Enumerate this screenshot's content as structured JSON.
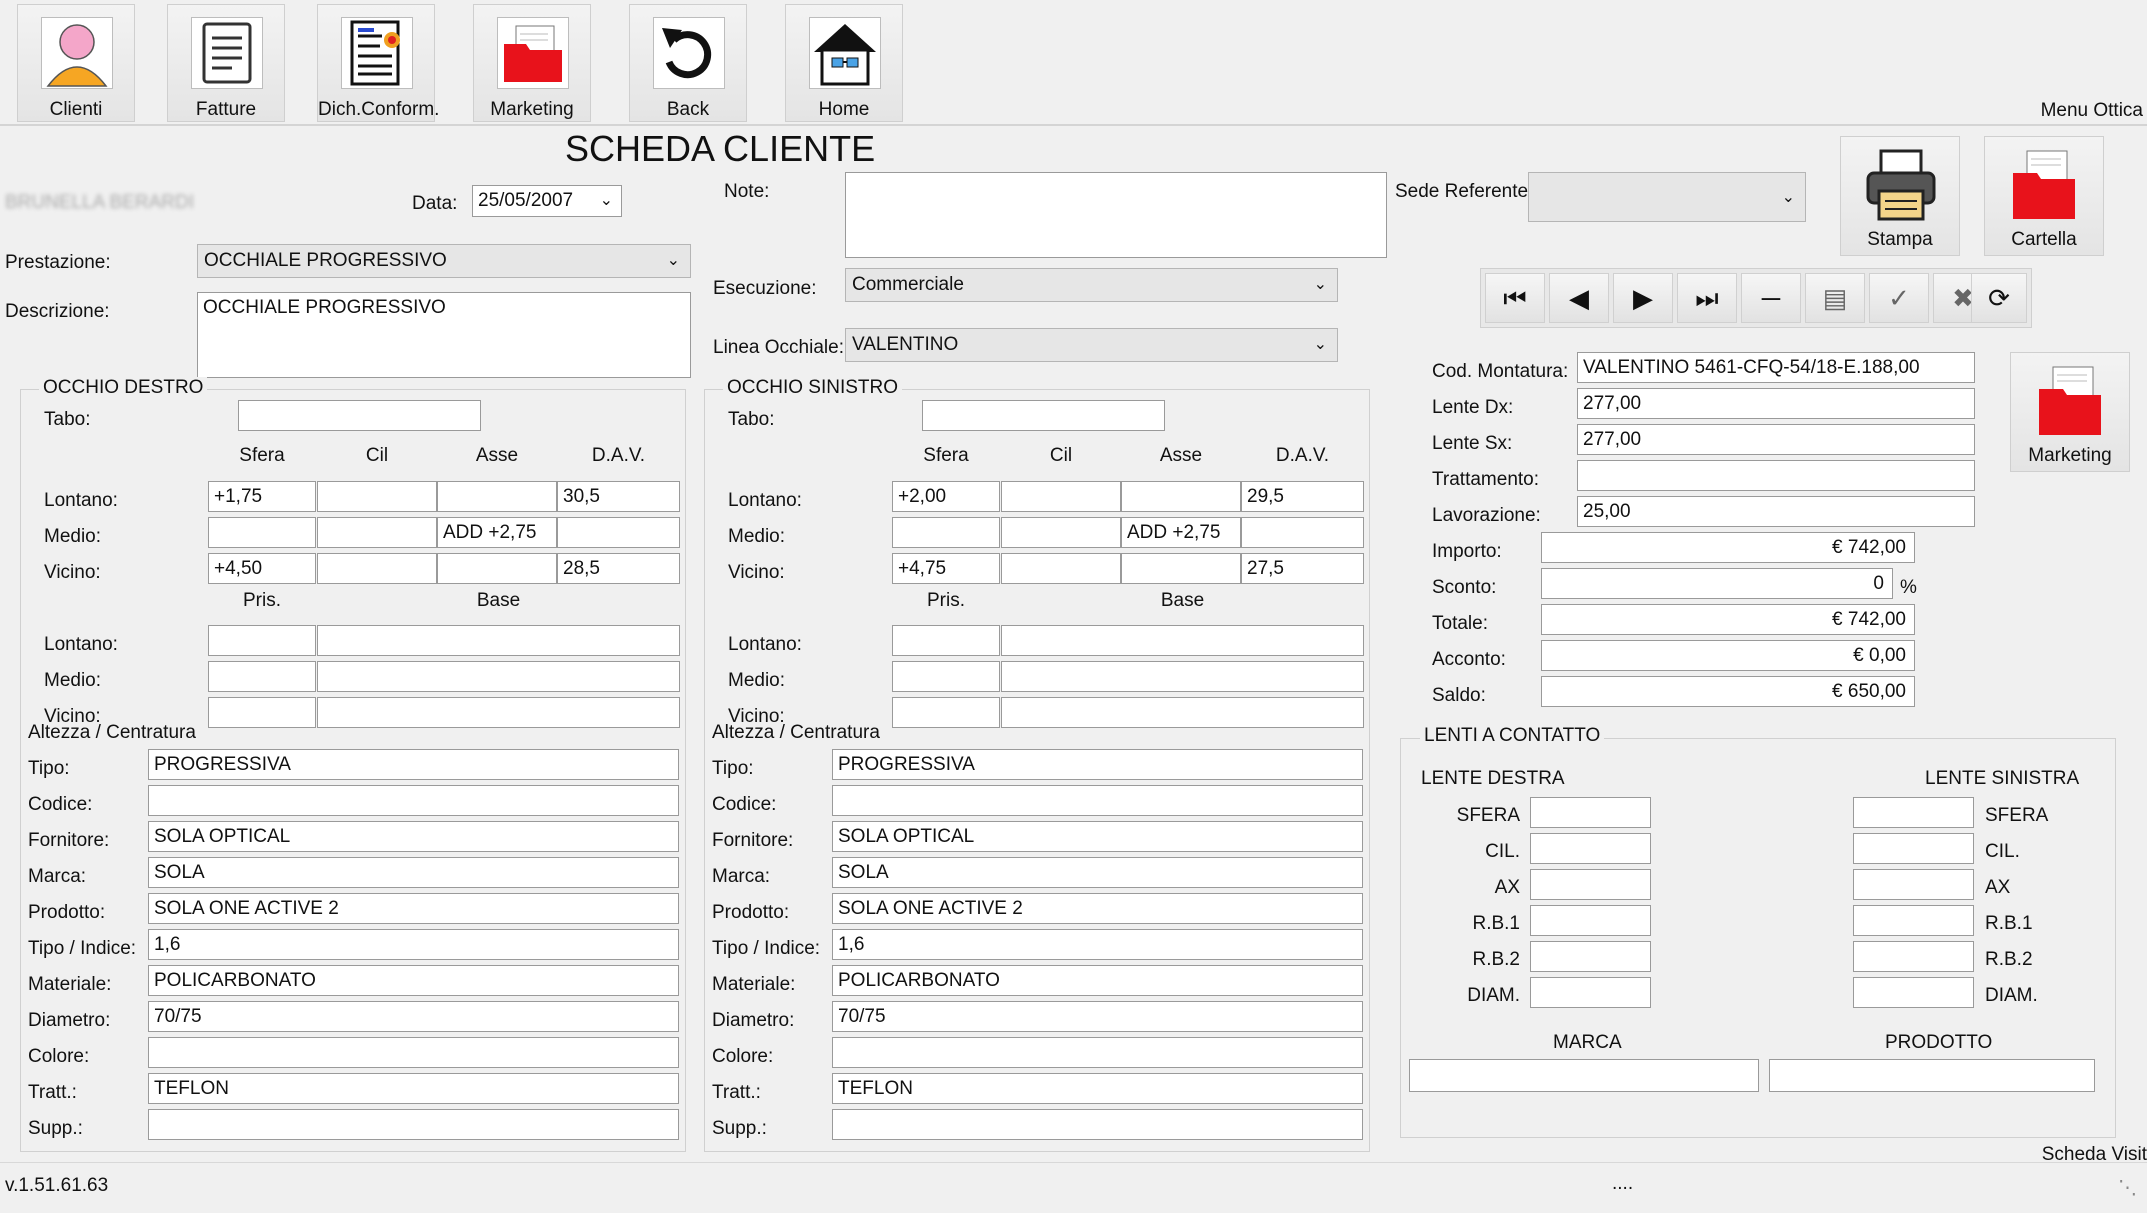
{
  "toolbar": {
    "buttons": [
      {
        "label": "Clienti",
        "icon": "person-icon"
      },
      {
        "label": "Fatture",
        "icon": "invoice-icon"
      },
      {
        "label": "Dich.Conform.",
        "icon": "document-seal-icon"
      },
      {
        "label": "Marketing",
        "icon": "folder-icon"
      },
      {
        "label": "Back",
        "icon": "undo-icon"
      },
      {
        "label": "Home",
        "icon": "home-icon"
      }
    ],
    "menu_label": "Menu Ottica"
  },
  "form": {
    "title": "SCHEDA CLIENTE",
    "customer_name": "BRUNELLA BERARDI",
    "data_label": "Data:",
    "data_value": "25/05/2007",
    "note_label": "Note:",
    "note_value": "",
    "sede_label": "Sede Referente:",
    "sede_value": "",
    "prestazione_label": "Prestazione:",
    "prestazione_value": "OCCHIALE PROGRESSIVO",
    "descrizione_label": "Descrizione:",
    "descrizione_value": "OCCHIALE PROGRESSIVO",
    "esecuzione_label": "Esecuzione:",
    "esecuzione_value": "Commerciale",
    "linea_label": "Linea Occhiale:",
    "linea_value": "VALENTINO"
  },
  "actions": {
    "stampa": "Stampa",
    "cartella": "Cartella",
    "marketing": "Marketing"
  },
  "eye_labels": {
    "tabo": "Tabo:",
    "sfera": "Sfera",
    "cil": "Cil",
    "asse": "Asse",
    "dav": "D.A.V.",
    "lontano": "Lontano:",
    "medio": "Medio:",
    "vicino": "Vicino:",
    "pris": "Pris.",
    "base": "Base",
    "altezza": "Altezza / Centratura",
    "tipo": "Tipo:",
    "codice": "Codice:",
    "fornitore": "Fornitore:",
    "marca": "Marca:",
    "prodotto": "Prodotto:",
    "tipo_indice": "Tipo / Indice:",
    "materiale": "Materiale:",
    "diametro": "Diametro:",
    "colore": "Colore:",
    "tratt": "Tratt.:",
    "supp": "Supp.:"
  },
  "occhio_destro": {
    "title": "OCCHIO DESTRO",
    "tabo": "",
    "lontano": {
      "sfera": "+1,75",
      "cil": "",
      "asse": "",
      "dav": "30,5"
    },
    "medio": {
      "sfera": "",
      "cil": "",
      "asse": "ADD +2,75",
      "dav": ""
    },
    "vicino": {
      "sfera": "+4,50",
      "cil": "",
      "asse": "",
      "dav": "28,5"
    },
    "tipo": "PROGRESSIVA",
    "codice": "",
    "fornitore": "SOLA OPTICAL",
    "marca": "SOLA",
    "prodotto": "SOLA ONE ACTIVE 2",
    "tipo_indice": "1,6",
    "materiale": "POLICARBONATO",
    "diametro": "70/75",
    "colore": "",
    "tratt": "TEFLON",
    "supp": ""
  },
  "occhio_sinistro": {
    "title": "OCCHIO SINISTRO",
    "tabo": "",
    "lontano": {
      "sfera": "+2,00",
      "cil": "",
      "asse": "",
      "dav": "29,5"
    },
    "medio": {
      "sfera": "",
      "cil": "",
      "asse": "ADD +2,75",
      "dav": ""
    },
    "vicino": {
      "sfera": "+4,75",
      "cil": "",
      "asse": "",
      "dav": "27,5"
    },
    "tipo": "PROGRESSIVA",
    "codice": "",
    "fornitore": "SOLA OPTICAL",
    "marca": "SOLA",
    "prodotto": "SOLA ONE ACTIVE 2",
    "tipo_indice": "1,6",
    "materiale": "POLICARBONATO",
    "diametro": "70/75",
    "colore": "",
    "tratt": "TEFLON",
    "supp": ""
  },
  "montatura": {
    "cod_label": "Cod. Montatura:",
    "cod_value": "VALENTINO 5461-CFQ-54/18-E.188,00",
    "dx_label": "Lente Dx:",
    "dx_value": "277,00",
    "sx_label": "Lente Sx:",
    "sx_value": "277,00",
    "trattamento_label": "Trattamento:",
    "trattamento_value": "",
    "lavorazione_label": "Lavorazione:",
    "lavorazione_value": "25,00",
    "importo_label": "Importo:",
    "importo_value": "€ 742,00",
    "sconto_label": "Sconto:",
    "sconto_value": "0",
    "sconto_unit": "%",
    "totale_label": "Totale:",
    "totale_value": "€ 742,00",
    "acconto_label": "Acconto:",
    "acconto_value": "€ 0,00",
    "saldo_label": "Saldo:",
    "saldo_value": "€ 650,00"
  },
  "lenti_contatto": {
    "title": "LENTI A CONTATTO",
    "destra": "LENTE DESTRA",
    "sinistra": "LENTE SINISTRA",
    "rows": [
      "SFERA",
      "CIL.",
      "AX",
      "R.B.1",
      "R.B.2",
      "DIAM."
    ],
    "marca": "MARCA",
    "prodotto": "PRODOTTO"
  },
  "footer": {
    "version": "v.1.51.61.63",
    "status": "....",
    "scheda": "Scheda Visit"
  }
}
